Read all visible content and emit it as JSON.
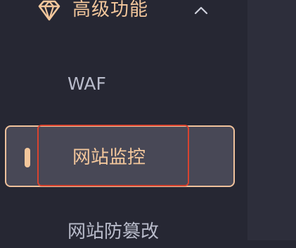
{
  "sidebar": {
    "group": {
      "title": "高级功能",
      "icon": "diamond-icon",
      "toggle_icon": "chevron-up-icon"
    },
    "items": [
      {
        "label": "WAF",
        "active": false
      },
      {
        "label": "网站监控",
        "active": true
      },
      {
        "label": "网站防篡改",
        "active": false
      }
    ]
  },
  "colors": {
    "sidebar_bg": "#262733",
    "content_bg": "#2d2e3b",
    "accent": "#f3c79c",
    "active_bg": "#484856",
    "text_muted": "#b9bccb",
    "highlight_border": "#d9432f"
  }
}
